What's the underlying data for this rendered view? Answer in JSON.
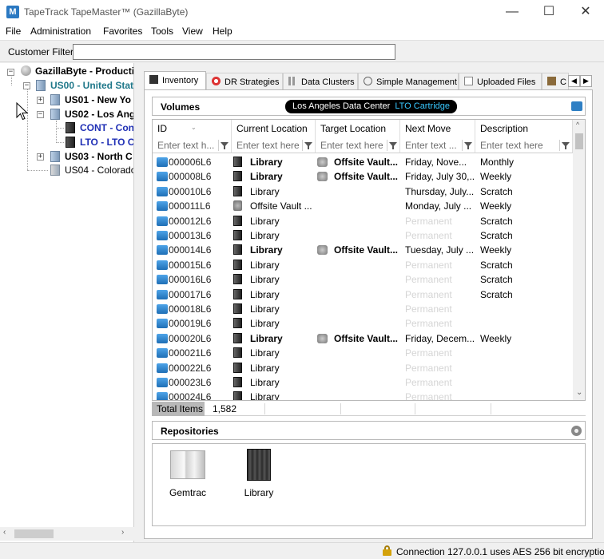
{
  "window": {
    "title": "TapeTrack TapeMaster™ (GazillaByte)",
    "app_icon_letter": "M",
    "minimize": "—",
    "maximize": "☐",
    "close": "✕"
  },
  "menu": [
    "File",
    "Administration",
    "Favorites",
    "Tools",
    "View",
    "Help"
  ],
  "customer_filter": {
    "label": "Customer Filter",
    "value": ""
  },
  "tree": {
    "root": "GazillaByte - Productio",
    "us00": "US00 - United Stat",
    "us01": "US01 - New Yo",
    "us02": "US02 - Los Ange",
    "cont": "CONT - Cont",
    "lto": "LTO - LTO C",
    "us03": "US03 - North C",
    "us04": "US04 - Colorado"
  },
  "tabs": [
    "Inventory",
    "DR Strategies",
    "Data Clusters",
    "Simple Management",
    "Uploaded Files",
    "C"
  ],
  "volumes": {
    "title": "Volumes",
    "context_location": "Los Angeles Data Center",
    "context_media": "LTO Cartridge",
    "columns": [
      "ID",
      "Current Location",
      "Target Location",
      "Next Move",
      "Description"
    ],
    "filter_placeholders": [
      "Enter text h...",
      "Enter text here",
      "Enter text here",
      "Enter text ...",
      "Enter text here"
    ],
    "rows": [
      {
        "id": "000006L6",
        "loc": "Library",
        "loc_bold": true,
        "tgt": "Offsite Vault...",
        "next": "Friday, Nove...",
        "perm": false,
        "desc": "Monthly"
      },
      {
        "id": "000008L6",
        "loc": "Library",
        "loc_bold": true,
        "tgt": "Offsite Vault...",
        "next": "Friday, July 30,...",
        "perm": false,
        "desc": "Weekly"
      },
      {
        "id": "000010L6",
        "loc": "Library",
        "loc_bold": false,
        "tgt": "",
        "next": "Thursday, July...",
        "perm": false,
        "desc": "Scratch"
      },
      {
        "id": "000011L6",
        "loc": "Offsite Vault ...",
        "loc_bold": false,
        "loc_vault": true,
        "tgt": "",
        "next": "Monday, July ...",
        "perm": false,
        "desc": "Weekly"
      },
      {
        "id": "000012L6",
        "loc": "Library",
        "loc_bold": false,
        "tgt": "",
        "next": "Permanent",
        "perm": true,
        "desc": "Scratch"
      },
      {
        "id": "000013L6",
        "loc": "Library",
        "loc_bold": false,
        "tgt": "",
        "next": "Permanent",
        "perm": true,
        "desc": "Scratch"
      },
      {
        "id": "000014L6",
        "loc": "Library",
        "loc_bold": true,
        "tgt": "Offsite Vault...",
        "next": "Tuesday, July ...",
        "perm": false,
        "desc": "Weekly"
      },
      {
        "id": "000015L6",
        "loc": "Library",
        "loc_bold": false,
        "tgt": "",
        "next": "Permanent",
        "perm": true,
        "desc": "Scratch"
      },
      {
        "id": "000016L6",
        "loc": "Library",
        "loc_bold": false,
        "tgt": "",
        "next": "Permanent",
        "perm": true,
        "desc": "Scratch"
      },
      {
        "id": "000017L6",
        "loc": "Library",
        "loc_bold": false,
        "tgt": "",
        "next": "Permanent",
        "perm": true,
        "desc": "Scratch"
      },
      {
        "id": "000018L6",
        "loc": "Library",
        "loc_bold": false,
        "tgt": "",
        "next": "Permanent",
        "perm": true,
        "desc": ""
      },
      {
        "id": "000019L6",
        "loc": "Library",
        "loc_bold": false,
        "tgt": "",
        "next": "Permanent",
        "perm": true,
        "desc": ""
      },
      {
        "id": "000020L6",
        "loc": "Library",
        "loc_bold": true,
        "tgt": "Offsite Vault...",
        "next": "Friday, Decem...",
        "perm": false,
        "desc": "Weekly"
      },
      {
        "id": "000021L6",
        "loc": "Library",
        "loc_bold": false,
        "tgt": "",
        "next": "Permanent",
        "perm": true,
        "desc": ""
      },
      {
        "id": "000022L6",
        "loc": "Library",
        "loc_bold": false,
        "tgt": "",
        "next": "Permanent",
        "perm": true,
        "desc": ""
      },
      {
        "id": "000023L6",
        "loc": "Library",
        "loc_bold": false,
        "tgt": "",
        "next": "Permanent",
        "perm": true,
        "desc": ""
      },
      {
        "id": "000024L6",
        "loc": "Library",
        "loc_bold": false,
        "tgt": "",
        "next": "Permanent",
        "perm": true,
        "desc": ""
      }
    ],
    "total_label": "Total Items",
    "total_value": "1,582"
  },
  "repositories": {
    "title": "Repositories",
    "items": [
      "Gemtrac",
      "Library"
    ]
  },
  "status": {
    "text": "Connection 127.0.0.1 uses AES 256 bit encryptio"
  }
}
